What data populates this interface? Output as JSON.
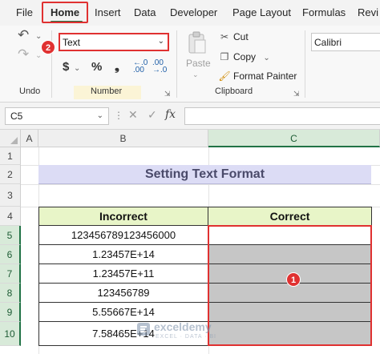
{
  "ribbon_tabs": [
    "File",
    "Home",
    "Insert",
    "Data",
    "Developer",
    "Page Layout",
    "Formulas",
    "Revi"
  ],
  "active_tab": "Home",
  "groups": {
    "undo_label": "Undo",
    "number_label": "Number",
    "clipboard_label": "Clipboard"
  },
  "number_format": {
    "value": "Text"
  },
  "number_icons": {
    "currency": "$",
    "percent": "%",
    "comma": "❟",
    "increase_decimal": "←.0\n.00",
    "decrease_decimal": ".00\n→.0"
  },
  "clipboard": {
    "paste_label": "Paste",
    "cut_label": "Cut",
    "copy_label": "Copy",
    "format_painter_label": "Format Painter"
  },
  "font": {
    "name": "Calibri"
  },
  "formula_bar": {
    "name_box": "C5",
    "fx_label": "fx",
    "formula": ""
  },
  "badges": {
    "step_1": "1",
    "step_2": "2"
  },
  "columns": [
    "A",
    "B",
    "C"
  ],
  "rows": [
    "1",
    "2",
    "3",
    "4",
    "5",
    "6",
    "7",
    "8",
    "9",
    "10"
  ],
  "sheet": {
    "title": "Setting Text Format",
    "headers": {
      "incorrect": "Incorrect",
      "correct": "Correct"
    },
    "incorrect_values": [
      "123456789123456000",
      "1.23457E+14",
      "1.23457E+11",
      "123456789",
      "5.55667E+14",
      "7.58465E+14"
    ]
  },
  "watermark": {
    "name": "exceldemy",
    "tagline": "EXCEL · DATA · BI"
  },
  "colors": {
    "excel_green": "#217346",
    "highlight_red": "#e03131",
    "title_fill": "#dcdcf5",
    "header_fill": "#e8f5c8",
    "selection_fill": "#c6c6c6"
  }
}
